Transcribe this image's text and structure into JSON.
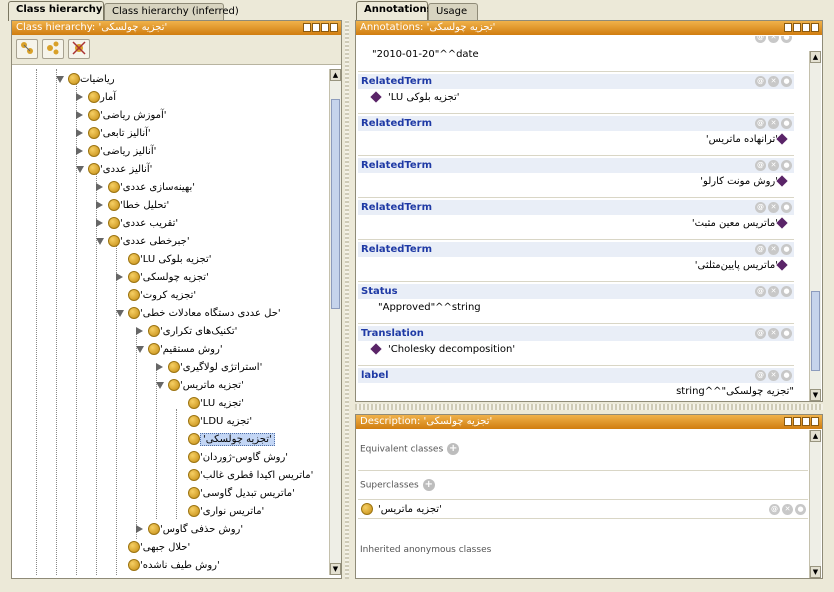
{
  "left_tabs": {
    "tab1": "Class hierarchy",
    "tab2": "Class hierarchy (inferred)"
  },
  "right_tabs": {
    "tab1": "Annotations",
    "tab2": "Usage"
  },
  "class_panel": {
    "title": "Class hierarchy: 'تجزیه چولسکی'"
  },
  "annotations_panel": {
    "title": "Annotations: 'تجزیه چولسکی'",
    "top_value": "\"2010-01-20\"^^date",
    "rows": [
      {
        "property": "RelatedTerm",
        "value": "'LU تجزیه بلوکی'"
      },
      {
        "property": "RelatedTerm",
        "value": "'ترانهاده ماتریس'"
      },
      {
        "property": "RelatedTerm",
        "value": "'روش مونت کارلو'"
      },
      {
        "property": "RelatedTerm",
        "value": "'ماتریس معین مثبت'"
      },
      {
        "property": "RelatedTerm",
        "value": "'ماتریس پایین‌مثلثی'"
      },
      {
        "property": "Status",
        "value": "\"Approved\"^^string"
      },
      {
        "property": "Translation",
        "value": "'Cholesky decomposition'"
      },
      {
        "property": "label",
        "value": "\"تجزیه چولسکی\"^^string"
      }
    ]
  },
  "description_panel": {
    "title": "Description: 'تجزیه چولسکی'",
    "equivalent_label": "Equivalent classes",
    "superclasses_label": "Superclasses",
    "superclass_value": "'تجزیه ماتریس'",
    "inherited_label": "Inherited anonymous classes"
  },
  "tree": [
    {
      "label": "ریاضیات"
    },
    {
      "label": "آمار"
    },
    {
      "label": "'آموزش ریاضی'"
    },
    {
      "label": "'آنالیز تابعی'"
    },
    {
      "label": "'آنالیز ریاضی'"
    },
    {
      "label": "'آنالیز عددی'"
    },
    {
      "label": "'بهینه‌سازی عددی'"
    },
    {
      "label": "'تحلیل خطا'"
    },
    {
      "label": "'تقریب عددی'"
    },
    {
      "label": "'جبرخطی عددی'"
    },
    {
      "label": "'LU تجزیه بلوکی'"
    },
    {
      "label": "'تجزیه چولسکی'"
    },
    {
      "label": "'تجزیه کروت'"
    },
    {
      "label": "'حل عددی دستگاه معادلات خطی'"
    },
    {
      "label": "'تکنیک‌های تکراری'"
    },
    {
      "label": "'روش مستقیم'"
    },
    {
      "label": "'استراتژی لولاگیری'"
    },
    {
      "label": "'تجزیه ماتریس'"
    },
    {
      "label": "'تجزیه LU'"
    },
    {
      "label": "'تجزیه LDU'"
    },
    {
      "label": "'تجزیه چولسکی'"
    },
    {
      "label": "'روش گاوس-ژوردان'"
    },
    {
      "label": "'ماتریس اکیدا قطری غالب'"
    },
    {
      "label": "'ماتریس تبدیل گاوسی'"
    },
    {
      "label": "'ماتریس نواری'"
    },
    {
      "label": "'روش حذفی گاوس'"
    },
    {
      "label": "'حلال جبهی'"
    },
    {
      "label": "'روش طیف ناشده'"
    }
  ],
  "colors": {
    "title_bar": "#e0951c",
    "class_bullet": "#d9a12a",
    "property_text": "#1f3aa5",
    "individual_diamond": "#5a2468",
    "selection": "#c3d6f5"
  }
}
